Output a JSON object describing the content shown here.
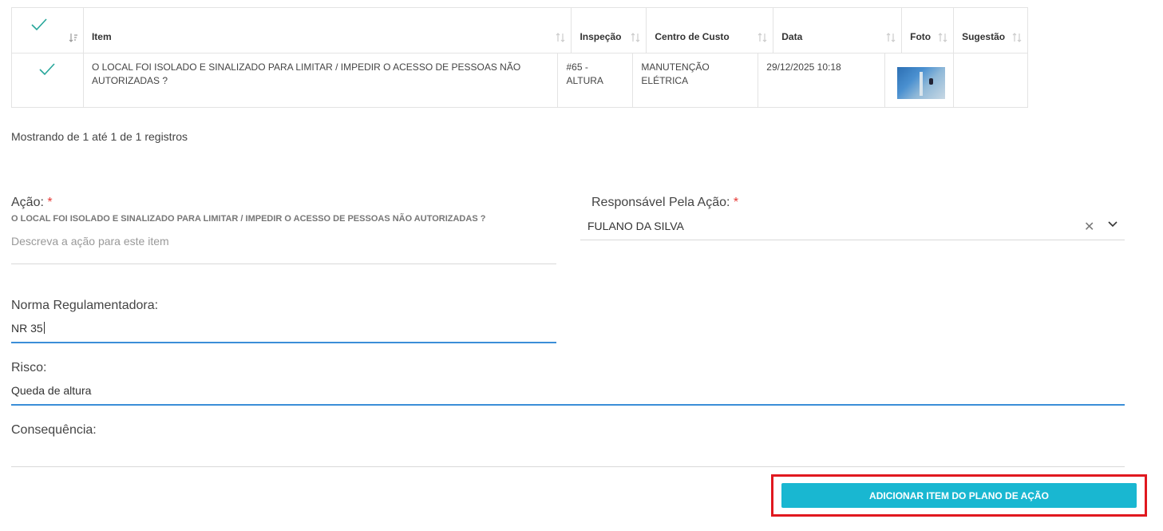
{
  "table": {
    "headers": {
      "item": "Item",
      "inspecao": "Inspeção",
      "centro": "Centro de Custo",
      "data": "Data",
      "foto": "Foto",
      "sugestao": "Sugestão"
    },
    "rows": [
      {
        "item": "O LOCAL FOI ISOLADO E SINALIZADO PARA LIMITAR / IMPEDIR O ACESSO DE PESSOAS NÃO AUTORIZADAS ?",
        "inspecao": "#65 - ALTURA",
        "centro": "MANUTENÇÃO ELÉTRICA",
        "data": "29/12/2025 10:18",
        "sugestao": ""
      }
    ],
    "info": "Mostrando de 1 até 1 de 1 registros"
  },
  "form": {
    "acao": {
      "label": "Ação:",
      "required": "*",
      "item_text": "O LOCAL FOI ISOLADO E SINALIZADO PARA LIMITAR / IMPEDIR O ACESSO DE PESSOAS NÃO AUTORIZADAS ?",
      "placeholder": "Descreva a ação para este item"
    },
    "responsavel": {
      "label": "Responsável Pela Ação:",
      "required": "*",
      "value": "FULANO DA SILVA",
      "clear": "✕"
    },
    "norma": {
      "label": "Norma Regulamentadora:",
      "value": "NR 35"
    },
    "risco": {
      "label": "Risco:",
      "value": "Queda de altura"
    },
    "consequencia": {
      "label": "Consequência:",
      "value": ""
    },
    "submit_label": "ADICIONAR ITEM DO PLANO DE AÇÃO"
  },
  "colors": {
    "accent": "#19b7d1",
    "check": "#26a69a",
    "focus": "#3b8ed8",
    "highlight": "#e0181f",
    "required": "#e53935"
  }
}
